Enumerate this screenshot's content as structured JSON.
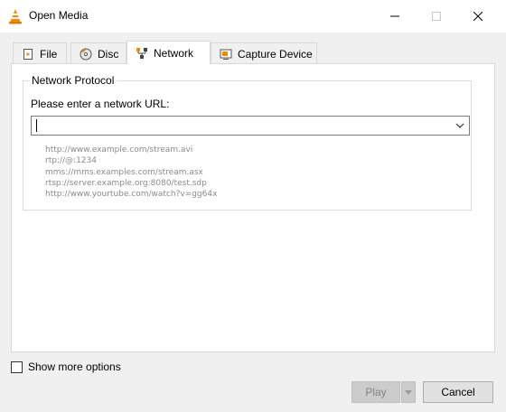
{
  "window": {
    "title": "Open Media",
    "controls": [
      "minimize",
      "maximize",
      "close"
    ]
  },
  "tabs": [
    {
      "label": "File",
      "icon": "file-icon",
      "active": false
    },
    {
      "label": "Disc",
      "icon": "disc-icon",
      "active": false
    },
    {
      "label": "Network",
      "icon": "network-icon",
      "active": true
    },
    {
      "label": "Capture Device",
      "icon": "capture-device-icon",
      "active": false
    }
  ],
  "network": {
    "group_title": "Network Protocol",
    "url_label": "Please enter a network URL:",
    "url_value": "",
    "examples": [
      "http://www.example.com/stream.avi",
      "rtp://@:1234",
      "mms://mms.examples.com/stream.asx",
      "rtsp://server.example.org:8080/test.sdp",
      "http://www.yourtube.com/watch?v=gg64x"
    ]
  },
  "options": {
    "show_more_label": "Show more options",
    "show_more_checked": false
  },
  "buttons": {
    "play": "Play",
    "cancel": "Cancel"
  },
  "colors": {
    "accent_orange": "#f08a00",
    "disabled_text": "#838383",
    "hint_text": "#8a8a8a"
  }
}
